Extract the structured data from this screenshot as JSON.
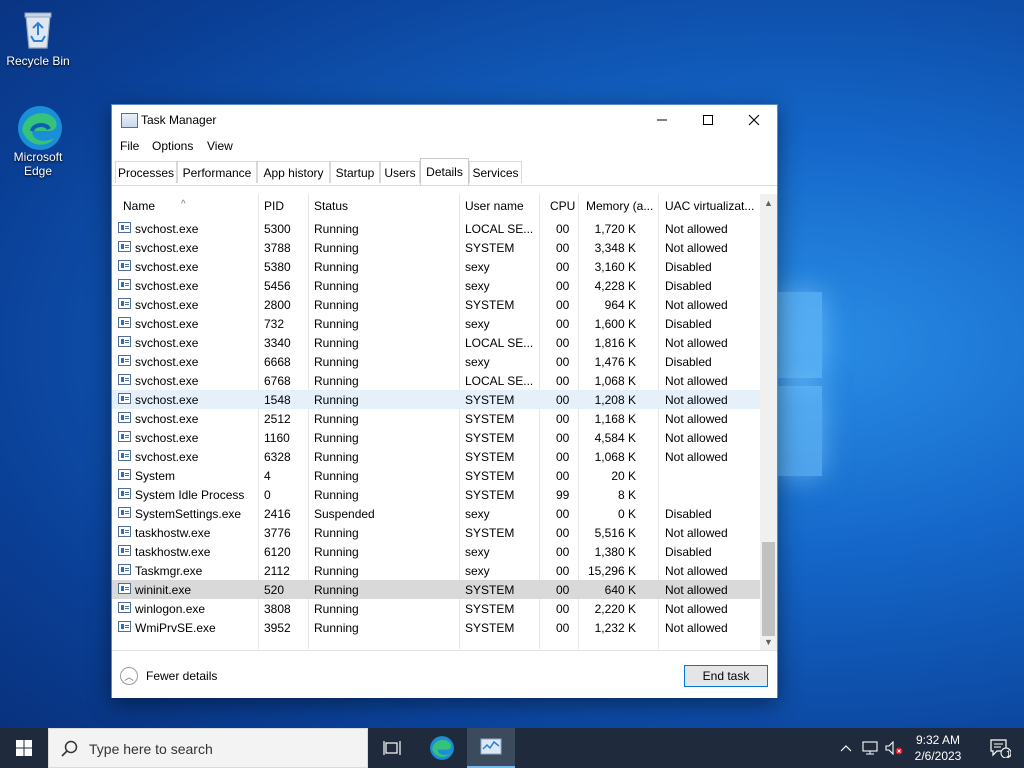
{
  "desktop": {
    "icons": [
      {
        "label": "Recycle Bin"
      },
      {
        "label": "Microsoft Edge"
      }
    ]
  },
  "window": {
    "title": "Task Manager",
    "menu": [
      "File",
      "Options",
      "View"
    ],
    "tabs": [
      "Processes",
      "Performance",
      "App history",
      "Startup",
      "Users",
      "Details",
      "Services"
    ],
    "active_tab": "Details",
    "columns": [
      "Name",
      "PID",
      "Status",
      "User name",
      "CPU",
      "Memory (a...",
      "UAC virtualizat..."
    ],
    "rows": [
      {
        "name": "svchost.exe",
        "pid": "5300",
        "status": "Running",
        "user": "LOCAL SE...",
        "cpu": "00",
        "mem": "1,720 K",
        "uac": "Not allowed"
      },
      {
        "name": "svchost.exe",
        "pid": "3788",
        "status": "Running",
        "user": "SYSTEM",
        "cpu": "00",
        "mem": "3,348 K",
        "uac": "Not allowed"
      },
      {
        "name": "svchost.exe",
        "pid": "5380",
        "status": "Running",
        "user": "sexy",
        "cpu": "00",
        "mem": "3,160 K",
        "uac": "Disabled"
      },
      {
        "name": "svchost.exe",
        "pid": "5456",
        "status": "Running",
        "user": "sexy",
        "cpu": "00",
        "mem": "4,228 K",
        "uac": "Disabled"
      },
      {
        "name": "svchost.exe",
        "pid": "2800",
        "status": "Running",
        "user": "SYSTEM",
        "cpu": "00",
        "mem": "964 K",
        "uac": "Not allowed"
      },
      {
        "name": "svchost.exe",
        "pid": "732",
        "status": "Running",
        "user": "sexy",
        "cpu": "00",
        "mem": "1,600 K",
        "uac": "Disabled"
      },
      {
        "name": "svchost.exe",
        "pid": "3340",
        "status": "Running",
        "user": "LOCAL SE...",
        "cpu": "00",
        "mem": "1,816 K",
        "uac": "Not allowed"
      },
      {
        "name": "svchost.exe",
        "pid": "6668",
        "status": "Running",
        "user": "sexy",
        "cpu": "00",
        "mem": "1,476 K",
        "uac": "Disabled"
      },
      {
        "name": "svchost.exe",
        "pid": "6768",
        "status": "Running",
        "user": "LOCAL SE...",
        "cpu": "00",
        "mem": "1,068 K",
        "uac": "Not allowed"
      },
      {
        "name": "svchost.exe",
        "pid": "1548",
        "status": "Running",
        "user": "SYSTEM",
        "cpu": "00",
        "mem": "1,208 K",
        "uac": "Not allowed"
      },
      {
        "name": "svchost.exe",
        "pid": "2512",
        "status": "Running",
        "user": "SYSTEM",
        "cpu": "00",
        "mem": "1,168 K",
        "uac": "Not allowed"
      },
      {
        "name": "svchost.exe",
        "pid": "1160",
        "status": "Running",
        "user": "SYSTEM",
        "cpu": "00",
        "mem": "4,584 K",
        "uac": "Not allowed"
      },
      {
        "name": "svchost.exe",
        "pid": "6328",
        "status": "Running",
        "user": "SYSTEM",
        "cpu": "00",
        "mem": "1,068 K",
        "uac": "Not allowed"
      },
      {
        "name": "System",
        "pid": "4",
        "status": "Running",
        "user": "SYSTEM",
        "cpu": "00",
        "mem": "20 K",
        "uac": ""
      },
      {
        "name": "System Idle Process",
        "pid": "0",
        "status": "Running",
        "user": "SYSTEM",
        "cpu": "99",
        "mem": "8 K",
        "uac": ""
      },
      {
        "name": "SystemSettings.exe",
        "pid": "2416",
        "status": "Suspended",
        "user": "sexy",
        "cpu": "00",
        "mem": "0 K",
        "uac": "Disabled"
      },
      {
        "name": "taskhostw.exe",
        "pid": "3776",
        "status": "Running",
        "user": "SYSTEM",
        "cpu": "00",
        "mem": "5,516 K",
        "uac": "Not allowed"
      },
      {
        "name": "taskhostw.exe",
        "pid": "6120",
        "status": "Running",
        "user": "sexy",
        "cpu": "00",
        "mem": "1,380 K",
        "uac": "Disabled"
      },
      {
        "name": "Taskmgr.exe",
        "pid": "2112",
        "status": "Running",
        "user": "sexy",
        "cpu": "00",
        "mem": "15,296 K",
        "uac": "Not allowed"
      },
      {
        "name": "wininit.exe",
        "pid": "520",
        "status": "Running",
        "user": "SYSTEM",
        "cpu": "00",
        "mem": "640 K",
        "uac": "Not allowed"
      },
      {
        "name": "winlogon.exe",
        "pid": "3808",
        "status": "Running",
        "user": "SYSTEM",
        "cpu": "00",
        "mem": "2,220 K",
        "uac": "Not allowed"
      },
      {
        "name": "WmiPrvSE.exe",
        "pid": "3952",
        "status": "Running",
        "user": "SYSTEM",
        "cpu": "00",
        "mem": "1,232 K",
        "uac": "Not allowed"
      }
    ],
    "hover_row": 9,
    "selected_row": 19,
    "footer": {
      "fewer_details": "Fewer details",
      "end_task": "End task"
    }
  },
  "taskbar": {
    "search_placeholder": "Type here to search",
    "time": "9:32 AM",
    "date": "2/6/2023",
    "notification_count": "1"
  },
  "colors": {
    "accent": "#0078d7",
    "hover_row": "#e5f0fb",
    "selected_row": "#d9d9d9",
    "taskbar": "#1f2b3c"
  }
}
